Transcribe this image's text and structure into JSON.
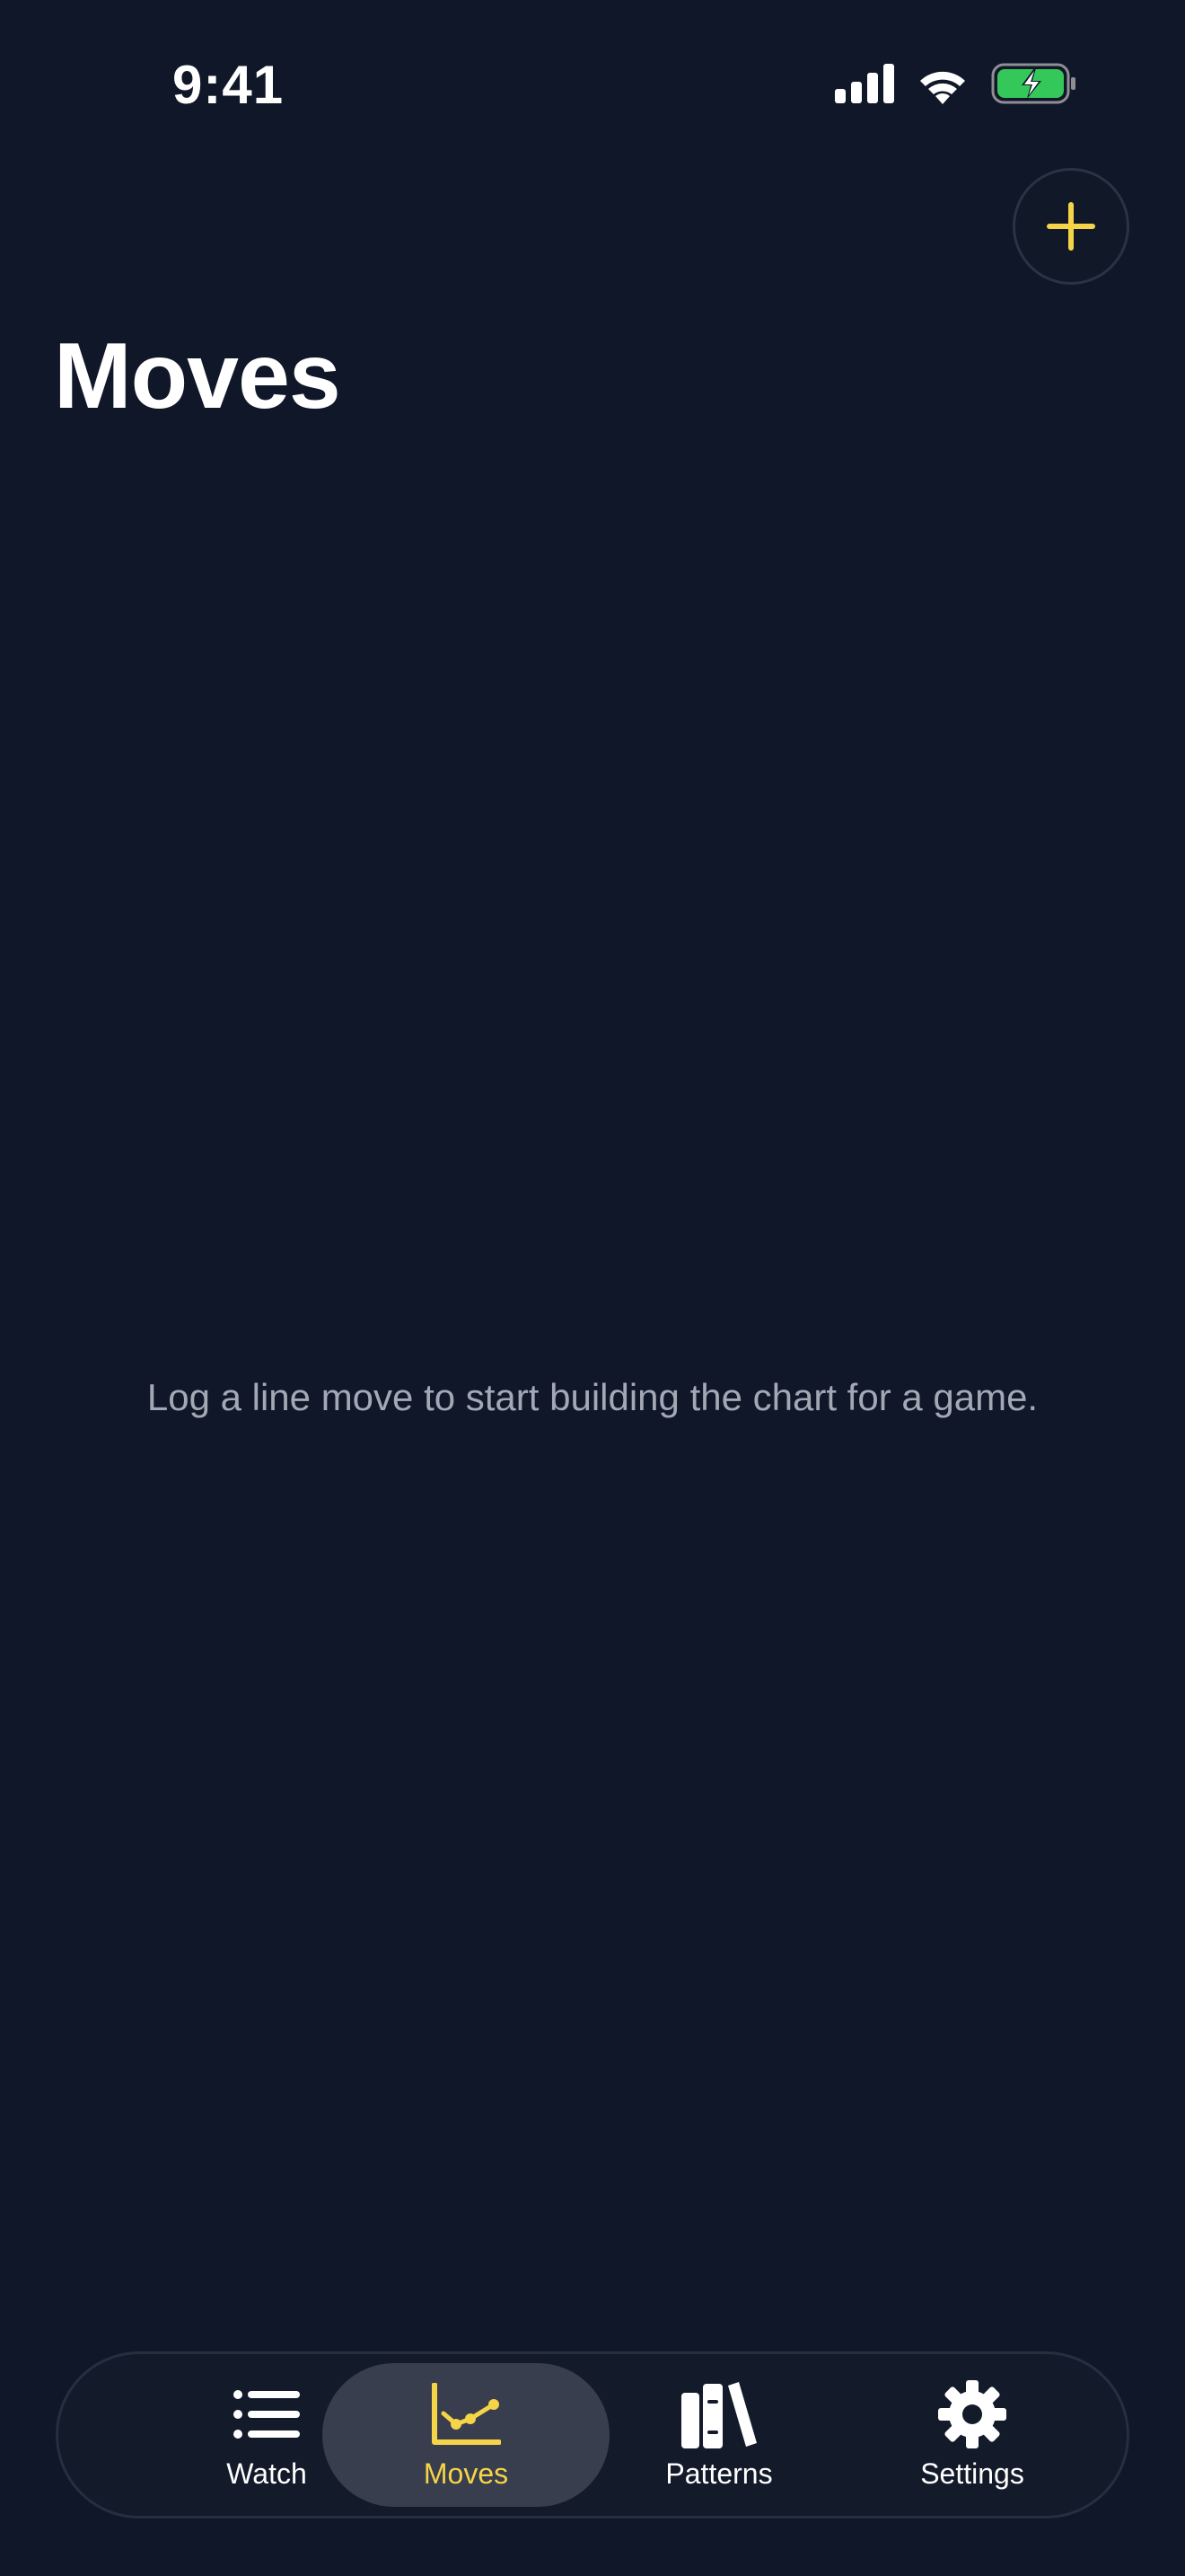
{
  "status_bar": {
    "time": "9:41"
  },
  "header": {
    "title": "Moves",
    "add_icon": "plus-icon"
  },
  "main": {
    "empty_message": "Log a line move to start building the chart for a game."
  },
  "tab_bar": {
    "tabs": [
      {
        "label": "Watch",
        "icon": "list-icon",
        "active": false
      },
      {
        "label": "Moves",
        "icon": "chart-line-icon",
        "active": true
      },
      {
        "label": "Patterns",
        "icon": "books-icon",
        "active": false
      },
      {
        "label": "Settings",
        "icon": "gear-icon",
        "active": false
      }
    ]
  },
  "colors": {
    "background": "#101729",
    "accent": "#f5d547",
    "muted_text": "#a3a8b4",
    "battery_green": "#34c759"
  }
}
